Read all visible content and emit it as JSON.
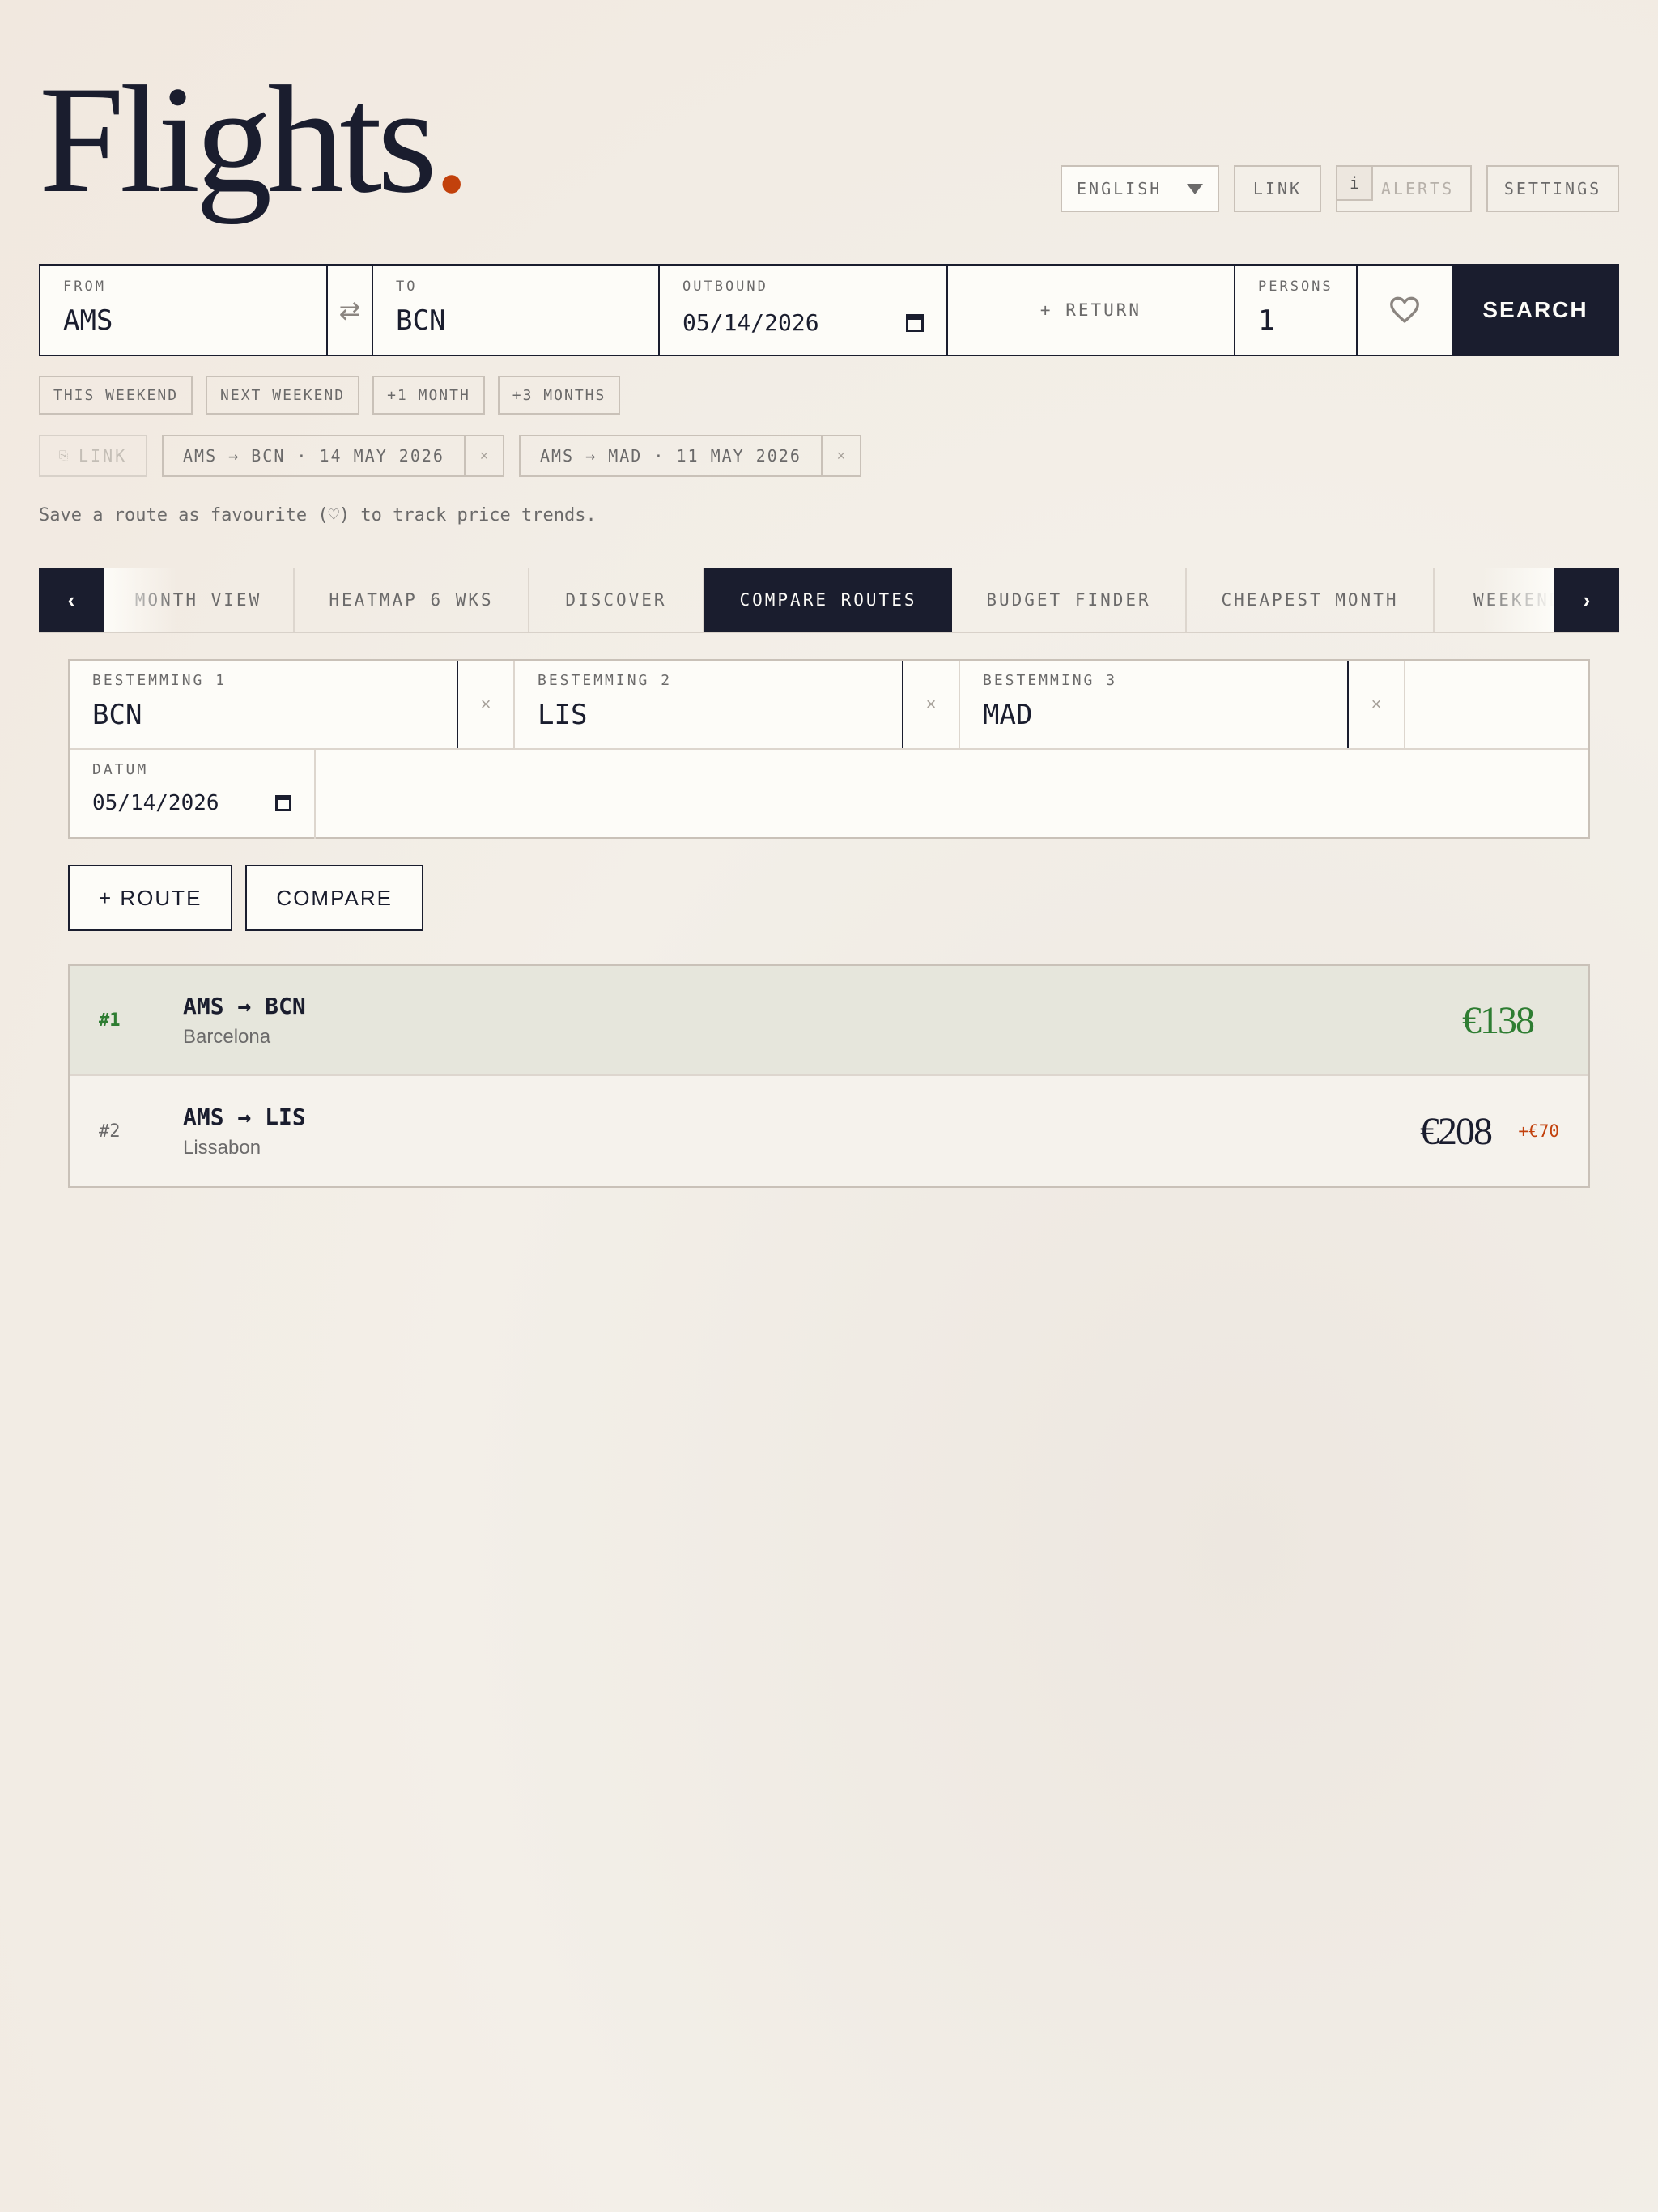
{
  "logo": {
    "text": "Flights",
    "dot": "."
  },
  "topbar": {
    "language": "ENGLISH",
    "link": "LINK",
    "alerts_info": "i",
    "alerts": "ALERTS",
    "settings": "SETTINGS"
  },
  "search": {
    "from_label": "FROM",
    "from_value": "AMS",
    "swap_icon": "⇄",
    "to_label": "TO",
    "to_value": "BCN",
    "outbound_label": "OUTBOUND",
    "outbound_value": "05/14/2026",
    "return_label": "+ RETURN",
    "persons_label": "PERSONS",
    "persons_value": "1",
    "favourite_icon": "heart-icon",
    "submit": "SEARCH"
  },
  "quick_dates": [
    "THIS WEEKEND",
    "NEXT WEEKEND",
    "+1 MONTH",
    "+3 MONTHS"
  ],
  "saved": {
    "link_icon": "⎘",
    "link": "LINK",
    "routes": [
      "AMS → BCN · 14 MAY 2026",
      "AMS → MAD · 11 MAY 2026"
    ],
    "remove_icon": "×"
  },
  "hint": "Save a route as favourite (♡) to track price trends.",
  "tabs": {
    "prev": "‹",
    "next": "›",
    "items": [
      "MONTH VIEW",
      "HEATMAP 6 WKS",
      "DISCOVER",
      "COMPARE ROUTES",
      "BUDGET FINDER",
      "CHEAPEST MONTH",
      "WEEKEND"
    ],
    "active": "COMPARE ROUTES"
  },
  "compare": {
    "destinations": [
      {
        "label": "BESTEMMING 1",
        "value": "BCN"
      },
      {
        "label": "BESTEMMING 2",
        "value": "LIS"
      },
      {
        "label": "BESTEMMING 3",
        "value": "MAD"
      }
    ],
    "remove_icon": "×",
    "date_label": "DATUM",
    "date_value": "05/14/2026",
    "add_route": "+ ROUTE",
    "compare": "COMPARE"
  },
  "results": [
    {
      "rank": "#1",
      "route": "AMS → BCN",
      "city": "Barcelona",
      "price": "€138",
      "diff": ""
    },
    {
      "rank": "#2",
      "route": "AMS → LIS",
      "city": "Lissabon",
      "price": "€208",
      "diff": "+€70"
    }
  ],
  "colors": {
    "navy": "#1a1d2e",
    "accent": "#c2410c",
    "best": "#2e7d32",
    "background": "#f3efe8"
  }
}
